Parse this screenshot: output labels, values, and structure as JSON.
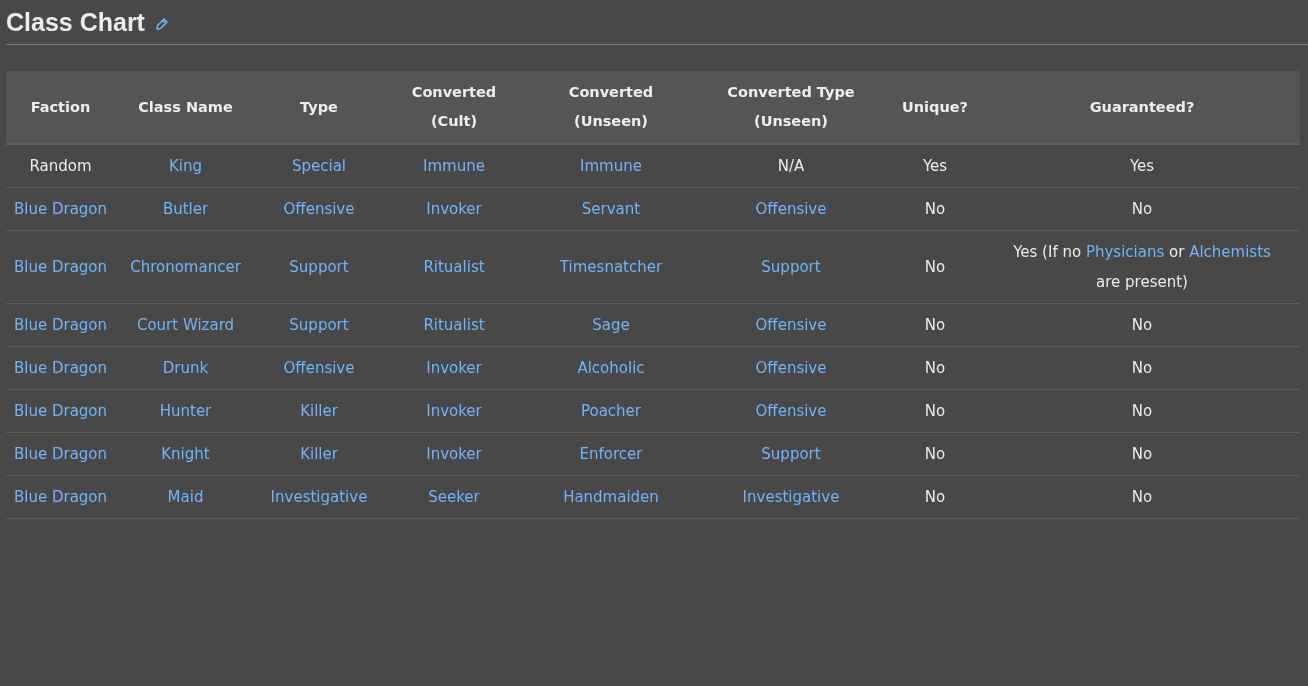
{
  "title": "Class Chart",
  "table": {
    "columns": [
      "Faction",
      "Class Name",
      "Type",
      "Converted\n(Cult)",
      "Converted\n(Unseen)",
      "Converted Type\n(Unseen)",
      "Unique?",
      "Guaranteed?"
    ],
    "rows": [
      [
        {
          "text": "Random",
          "link": false
        },
        {
          "text": "King",
          "link": true
        },
        {
          "text": "Special",
          "link": true
        },
        {
          "text": "Immune",
          "link": true
        },
        {
          "text": "Immune",
          "link": true
        },
        {
          "text": "N/A",
          "link": false
        },
        {
          "text": "Yes",
          "link": false
        },
        {
          "text": "Yes",
          "link": false
        }
      ],
      [
        {
          "text": "Blue Dragon",
          "link": true
        },
        {
          "text": "Butler",
          "link": true
        },
        {
          "text": "Offensive",
          "link": true
        },
        {
          "text": "Invoker",
          "link": true
        },
        {
          "text": "Servant",
          "link": true
        },
        {
          "text": "Offensive",
          "link": true
        },
        {
          "text": "No",
          "link": false
        },
        {
          "text": "No",
          "link": false
        }
      ],
      [
        {
          "text": "Blue Dragon",
          "link": true
        },
        {
          "text": "Chronomancer",
          "link": true
        },
        {
          "text": "Support",
          "link": true
        },
        {
          "text": "Ritualist",
          "link": true
        },
        {
          "text": "Timesnatcher",
          "link": true
        },
        {
          "text": "Support",
          "link": true
        },
        {
          "text": "No",
          "link": false
        },
        {
          "parts": [
            {
              "text": "Yes (If no ",
              "link": false
            },
            {
              "text": "Physicians",
              "link": true
            },
            {
              "text": " or ",
              "link": false
            },
            {
              "text": "Alchemists",
              "link": true
            },
            {
              "text": " are present)",
              "link": false
            }
          ]
        }
      ],
      [
        {
          "text": "Blue Dragon",
          "link": true
        },
        {
          "text": "Court Wizard",
          "link": true
        },
        {
          "text": "Support",
          "link": true
        },
        {
          "text": "Ritualist",
          "link": true
        },
        {
          "text": "Sage",
          "link": true
        },
        {
          "text": "Offensive",
          "link": true
        },
        {
          "text": "No",
          "link": false
        },
        {
          "text": "No",
          "link": false
        }
      ],
      [
        {
          "text": "Blue Dragon",
          "link": true
        },
        {
          "text": "Drunk",
          "link": true
        },
        {
          "text": "Offensive",
          "link": true
        },
        {
          "text": "Invoker",
          "link": true
        },
        {
          "text": "Alcoholic",
          "link": true
        },
        {
          "text": "Offensive",
          "link": true
        },
        {
          "text": "No",
          "link": false
        },
        {
          "text": "No",
          "link": false
        }
      ],
      [
        {
          "text": "Blue Dragon",
          "link": true
        },
        {
          "text": "Hunter",
          "link": true
        },
        {
          "text": "Killer",
          "link": true
        },
        {
          "text": "Invoker",
          "link": true
        },
        {
          "text": "Poacher",
          "link": true
        },
        {
          "text": "Offensive",
          "link": true
        },
        {
          "text": "No",
          "link": false
        },
        {
          "text": "No",
          "link": false
        }
      ],
      [
        {
          "text": "Blue Dragon",
          "link": true
        },
        {
          "text": "Knight",
          "link": true
        },
        {
          "text": "Killer",
          "link": true
        },
        {
          "text": "Invoker",
          "link": true
        },
        {
          "text": "Enforcer",
          "link": true
        },
        {
          "text": "Support",
          "link": true
        },
        {
          "text": "No",
          "link": false
        },
        {
          "text": "No",
          "link": false
        }
      ],
      [
        {
          "text": "Blue Dragon",
          "link": true
        },
        {
          "text": "Maid",
          "link": true
        },
        {
          "text": "Investigative",
          "link": true
        },
        {
          "text": "Seeker",
          "link": true
        },
        {
          "text": "Handmaiden",
          "link": true
        },
        {
          "text": "Investigative",
          "link": true
        },
        {
          "text": "No",
          "link": false
        },
        {
          "text": "No",
          "link": false
        }
      ]
    ]
  }
}
